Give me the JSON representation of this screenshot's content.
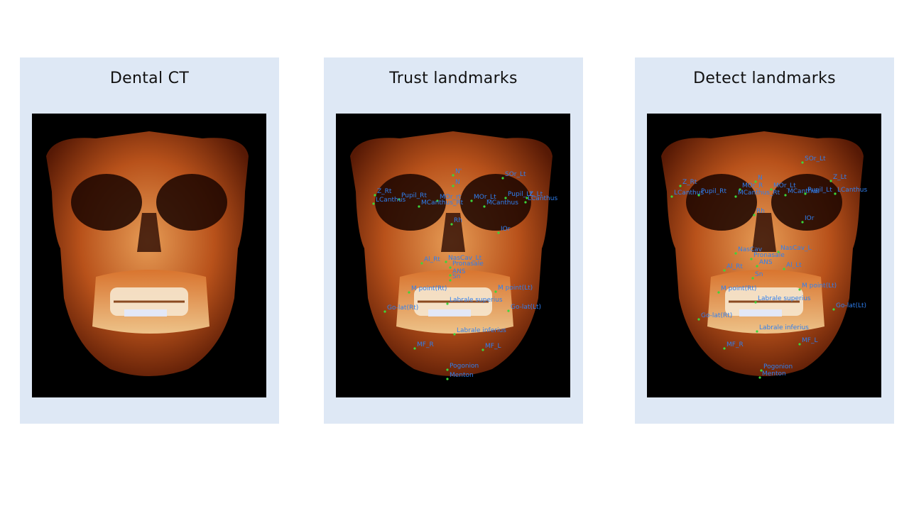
{
  "panels": [
    {
      "title": "Dental CT",
      "image": "ct-skull-render",
      "landmarks": []
    },
    {
      "title": "Trust landmarks",
      "image": "ct-skull-render-with-landmarks",
      "landmarks": [
        "N'",
        "N",
        "SOr_Lt",
        "Z_Rt",
        "Pupil_Rt",
        "LCanthus",
        "MOr_rt",
        "MOr_Lt",
        "Pupil_Lt",
        "Z_Lt",
        "LCanthus",
        "MCanthus_Rt",
        "MCanthus",
        "Rh",
        "IOr",
        "Al_Rt",
        "NasCav_Lt",
        "Pronasale",
        "ANS",
        "Sn",
        "M point(Rt)",
        "M point(Lt)",
        "Go-lat(Rt)",
        "Labrale superius",
        "Go-lat(Lt)",
        "Labrale inferius",
        "MF_R",
        "MF_L",
        "Pogonion",
        "Menton"
      ]
    },
    {
      "title": "Detect landmarks",
      "image": "ct-skull-render-with-landmarks",
      "landmarks": [
        "SOr_Lt",
        "Z_Rt",
        "N",
        "MOr_R",
        "MOr_Lt",
        "Z_Lt",
        "LCanthus",
        "Pupil_Rt",
        "MCanthus_Rt",
        "MCanthus",
        "Pupil_Lt",
        "LCanthus",
        "Rh",
        "IOr",
        "NasCav",
        "NasCav_L",
        "Pronasale",
        "ANS",
        "Al_Rt",
        "Al_Lt",
        "Sn",
        "M point(Rt)",
        "M point(Lt)",
        "Go-lat(Rt)",
        "Labrale superius",
        "Go-lat(Lt)",
        "Labrale inferius",
        "MF_R",
        "MF_L",
        "Pogonion",
        "Menton"
      ]
    }
  ],
  "colors": {
    "panel_bg": "#dee8f5",
    "landmark_label": "#2f7ff0",
    "landmark_dot": "#3bd73b"
  }
}
